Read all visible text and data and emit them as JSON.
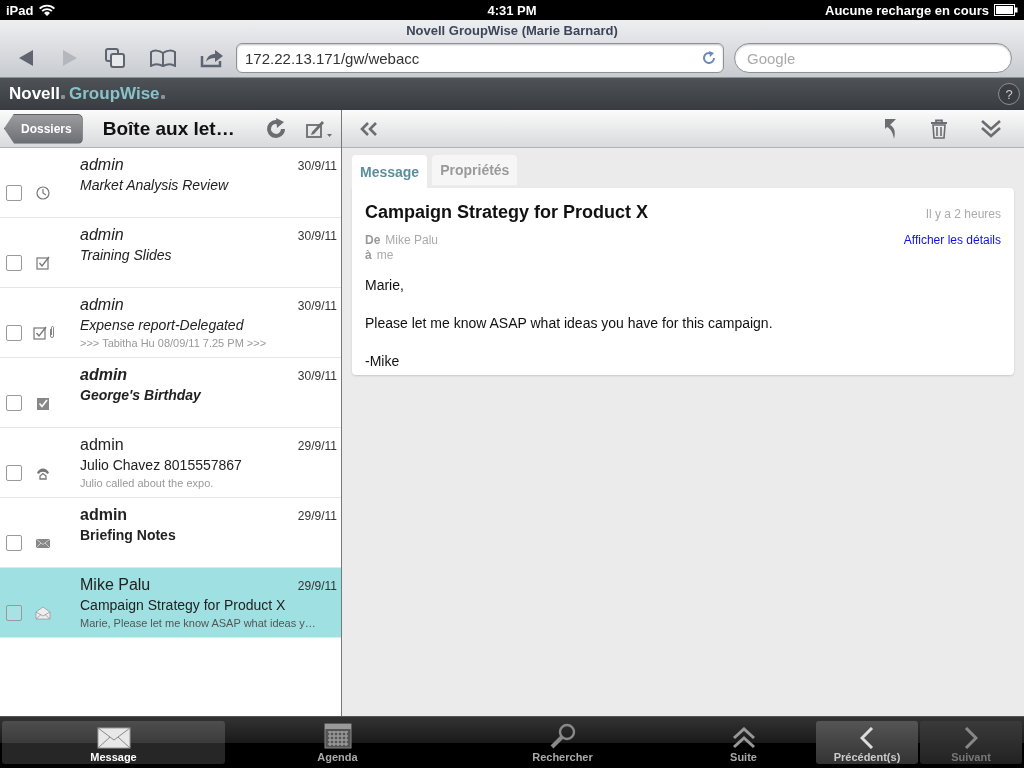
{
  "status_bar": {
    "device": "iPad",
    "time": "4:31 PM",
    "battery_text": "Aucune recharge en cours"
  },
  "browser": {
    "title": "Novell GroupWise (Marie Barnard)",
    "url": "172.22.13.171/gw/webacc",
    "search_placeholder": "Google"
  },
  "app_header": {
    "brand": "Novell",
    "product": "GroupWise",
    "help": "?"
  },
  "list_pane": {
    "back_button": "Dossiers",
    "title": "Boîte aux let…",
    "items": [
      {
        "kind": "appointment",
        "from": "admin",
        "subject": "Market Analysis Review",
        "date": "30/9/11",
        "unread": false,
        "attachment": false,
        "selected": false,
        "checked": false
      },
      {
        "kind": "task",
        "from": "admin",
        "subject": "Training Slides",
        "date": "30/9/11",
        "unread": false,
        "attachment": false,
        "selected": false,
        "checked": false
      },
      {
        "kind": "task",
        "from": "admin",
        "subject": "Expense report-Delegated",
        "preview": ">>> Tabitha Hu 08/09/11 7.25 PM >>>",
        "date": "30/9/11",
        "unread": false,
        "attachment": true,
        "selected": false,
        "checked": false
      },
      {
        "kind": "task_done",
        "from": "admin",
        "subject": "George's Birthday",
        "date": "30/9/11",
        "unread": true,
        "attachment": false,
        "selected": false,
        "checked": false
      },
      {
        "kind": "phone",
        "from": "admin",
        "subject": "Julio Chavez  8015557867",
        "preview": "Julio called about the expo.",
        "date": "29/9/11",
        "unread": false,
        "attachment": false,
        "selected": false,
        "checked": false
      },
      {
        "kind": "mail",
        "from": "admin",
        "subject": "Briefing Notes",
        "date": "29/9/11",
        "unread": true,
        "attachment": false,
        "selected": false,
        "checked": false
      },
      {
        "kind": "mail_opened",
        "from": "Mike Palu",
        "subject": "Campaign Strategy for Product X",
        "preview": "Marie, Please let me know ASAP what ideas y…",
        "date": "29/9/11",
        "unread": false,
        "attachment": false,
        "selected": true,
        "checked": false
      }
    ]
  },
  "message_pane": {
    "tabs": [
      {
        "label": "Message",
        "selected": true
      },
      {
        "label": "Propriétés",
        "selected": false
      }
    ],
    "subject": "Campaign Strategy for Product X",
    "time": "Il y a 2 heures",
    "from_label": "De",
    "from": "Mike Palu",
    "to_label": "à",
    "to": "me",
    "details_link": "Afficher les détails",
    "body": [
      "Marie,",
      "Please let me know ASAP what ideas you have for this campaign.",
      "-Mike"
    ]
  },
  "tab_bar": {
    "tabs": [
      {
        "kind": "mail",
        "label": "Message",
        "selected": true
      },
      {
        "kind": "calendar",
        "label": "Agenda",
        "selected": false
      },
      {
        "kind": "search",
        "label": "Rechercher",
        "selected": false
      },
      {
        "kind": "more",
        "label": "Suite",
        "selected": false
      }
    ],
    "nav": [
      {
        "kind": "prev",
        "label": "Précédent(s)",
        "disabled": false
      },
      {
        "kind": "next",
        "label": "Suivant",
        "disabled": true
      }
    ]
  }
}
